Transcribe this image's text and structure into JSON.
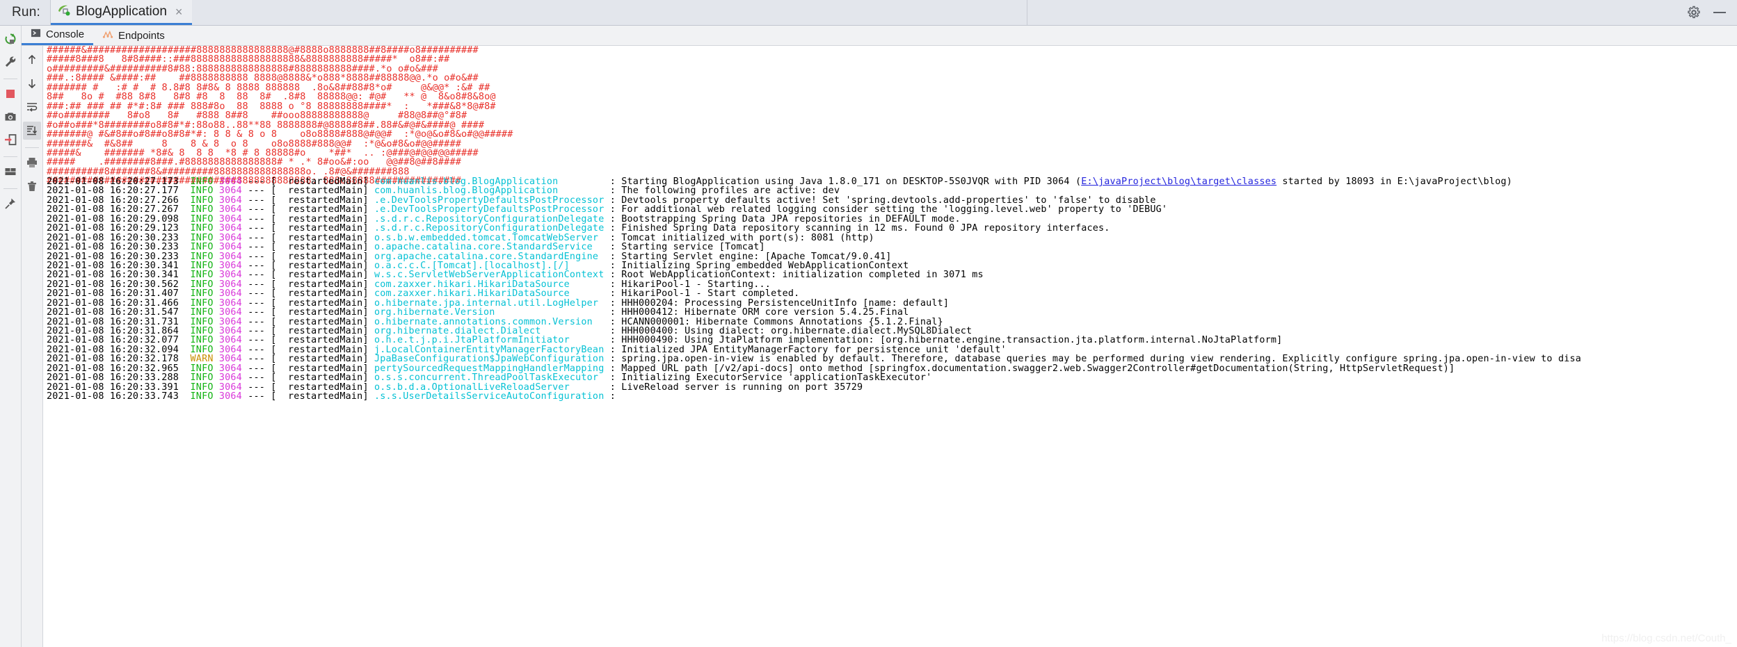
{
  "runbar": {
    "label": "Run:",
    "tab_title": "BlogApplication",
    "close_glyph": "×",
    "gear_name": "gear-icon",
    "minimize_name": "minimize-icon"
  },
  "left_toolbar": {
    "items": [
      {
        "name": "rerun-icon",
        "title": "Rerun"
      },
      {
        "name": "wrench-icon",
        "title": "Edit Configuration"
      },
      {
        "name": "stop-icon",
        "title": "Stop"
      },
      {
        "name": "camera-icon",
        "title": "Dump Threads"
      },
      {
        "name": "resume-icon",
        "title": "Resume Program"
      },
      {
        "name": "layout-icon",
        "title": "Layout"
      },
      {
        "name": "pin-icon",
        "title": "Pin Tab"
      }
    ]
  },
  "tabs": [
    {
      "label": "Console",
      "icon": "console-icon",
      "active": true
    },
    {
      "label": "Endpoints",
      "icon": "endpoints-icon",
      "active": false
    }
  ],
  "gutter_toolbar": {
    "items": [
      {
        "name": "arrow-up-icon",
        "title": "Up the Stack Trace"
      },
      {
        "name": "arrow-down-icon",
        "title": "Down the Stack Trace"
      },
      {
        "name": "soft-wrap-icon",
        "title": "Use Soft Wraps"
      },
      {
        "name": "scroll-to-end-icon",
        "title": "Scroll to the End",
        "selected": true
      },
      {
        "name": "print-icon",
        "title": "Print"
      },
      {
        "name": "trash-icon",
        "title": "Clear All"
      }
    ]
  },
  "banner": {
    "color": "#e8302a",
    "lines": [
      "######&###################8888888888888888@#8888o8888888##8####o8##########",
      "#####8###8   8#8####::###8888888888888888888&8888888888#####*  o8##:##",
      "o#########&##########8#88:8888888888888888#8888888888####.*o o#o&###",
      "###.:8#### &####:##    ##8888888888 8888@8888&*o888*8888##88888@@.*o o#o&##",
      "####### #   :# #  # 8.8#8 8#8& 8 8888 888888  .8o&8##88#8*o#     @&@@* :&# ##",
      "8##   8o #  #88 8#8   8#8 #8  8  88  8#  .8#8  88888@@: #@#   ** @  8&o8#8&8o@",
      "###:## ### ## #*#:8# ### 888#8o  88  8888 o °8 88888888####*  :   *###&8*8@#8#",
      "##o########   8#o8   8#   #888 8##8    ##ooo88888888888@     #88@8##@°#8#",
      "#o##o###*8########o8#8#*#:88o88..88**88 8888888#@8888#8##.88#&#@#&####@ ####",
      "#######@ #&#8##o#8##o8#8#*#: 8 8 & 8 o 8    o8o8888#888@#@@#  :*@o@&o#8&o#@@#####",
      "#######&  #&8##     8    8 & 8  o 8    o8o8888#888@@#  :*@&o#8&o#@@#####",
      "#####&    ####### *8#& 8  8 8  *8 # 8 88888#o    *##*  .. :@###@#@@#@@#####",
      "#####    .########8###.#8888888888888888# * .* 8#oo&#:oo   @@##8@##8####",
      "##########8#######8&#########8888888888888888o. .8#@&#######888",
      "#################################8888888888888: 888o88888###############"
    ]
  },
  "logs": [
    {
      "ts": "2021-01-08 16:20:27.173",
      "level": "INFO",
      "pid": "3064",
      "thread": "restartedMain",
      "cls": "com.huanlis.blog.BlogApplication",
      "msg": ": Starting BlogApplication using Java 1.8.0_171 on DESKTOP-5S0JVQR with PID 3064 (",
      "link": "E:\\javaProject\\blog\\target\\classes",
      "msg_after": " started by 18093 in E:\\javaProject\\blog)"
    },
    {
      "ts": "2021-01-08 16:20:27.177",
      "level": "INFO",
      "pid": "3064",
      "thread": "restartedMain",
      "cls": "com.huanlis.blog.BlogApplication",
      "msg": ": The following profiles are active: dev"
    },
    {
      "ts": "2021-01-08 16:20:27.266",
      "level": "INFO",
      "pid": "3064",
      "thread": "restartedMain",
      "cls": ".e.DevToolsPropertyDefaultsPostProcessor",
      "msg": ": Devtools property defaults active! Set 'spring.devtools.add-properties' to 'false' to disable"
    },
    {
      "ts": "2021-01-08 16:20:27.267",
      "level": "INFO",
      "pid": "3064",
      "thread": "restartedMain",
      "cls": ".e.DevToolsPropertyDefaultsPostProcessor",
      "msg": ": For additional web related logging consider setting the 'logging.level.web' property to 'DEBUG'"
    },
    {
      "ts": "2021-01-08 16:20:29.098",
      "level": "INFO",
      "pid": "3064",
      "thread": "restartedMain",
      "cls": ".s.d.r.c.RepositoryConfigurationDelegate",
      "msg": ": Bootstrapping Spring Data JPA repositories in DEFAULT mode."
    },
    {
      "ts": "2021-01-08 16:20:29.123",
      "level": "INFO",
      "pid": "3064",
      "thread": "restartedMain",
      "cls": ".s.d.r.c.RepositoryConfigurationDelegate",
      "msg": ": Finished Spring Data repository scanning in 12 ms. Found 0 JPA repository interfaces."
    },
    {
      "ts": "2021-01-08 16:20:30.233",
      "level": "INFO",
      "pid": "3064",
      "thread": "restartedMain",
      "cls": "o.s.b.w.embedded.tomcat.TomcatWebServer",
      "msg": ": Tomcat initialized with port(s): 8081 (http)"
    },
    {
      "ts": "2021-01-08 16:20:30.233",
      "level": "INFO",
      "pid": "3064",
      "thread": "restartedMain",
      "cls": "o.apache.catalina.core.StandardService",
      "msg": ": Starting service [Tomcat]"
    },
    {
      "ts": "2021-01-08 16:20:30.233",
      "level": "INFO",
      "pid": "3064",
      "thread": "restartedMain",
      "cls": "org.apache.catalina.core.StandardEngine",
      "msg": ": Starting Servlet engine: [Apache Tomcat/9.0.41]"
    },
    {
      "ts": "2021-01-08 16:20:30.341",
      "level": "INFO",
      "pid": "3064",
      "thread": "restartedMain",
      "cls": "o.a.c.c.C.[Tomcat].[localhost].[/]",
      "msg": ": Initializing Spring embedded WebApplicationContext"
    },
    {
      "ts": "2021-01-08 16:20:30.341",
      "level": "INFO",
      "pid": "3064",
      "thread": "restartedMain",
      "cls": "w.s.c.ServletWebServerApplicationContext",
      "msg": ": Root WebApplicationContext: initialization completed in 3071 ms"
    },
    {
      "ts": "2021-01-08 16:20:30.562",
      "level": "INFO",
      "pid": "3064",
      "thread": "restartedMain",
      "cls": "com.zaxxer.hikari.HikariDataSource",
      "msg": ": HikariPool-1 - Starting..."
    },
    {
      "ts": "2021-01-08 16:20:31.407",
      "level": "INFO",
      "pid": "3064",
      "thread": "restartedMain",
      "cls": "com.zaxxer.hikari.HikariDataSource",
      "msg": ": HikariPool-1 - Start completed."
    },
    {
      "ts": "2021-01-08 16:20:31.466",
      "level": "INFO",
      "pid": "3064",
      "thread": "restartedMain",
      "cls": "o.hibernate.jpa.internal.util.LogHelper",
      "msg": ": HHH000204: Processing PersistenceUnitInfo [name: default]"
    },
    {
      "ts": "2021-01-08 16:20:31.547",
      "level": "INFO",
      "pid": "3064",
      "thread": "restartedMain",
      "cls": "org.hibernate.Version",
      "msg": ": HHH000412: Hibernate ORM core version 5.4.25.Final"
    },
    {
      "ts": "2021-01-08 16:20:31.731",
      "level": "INFO",
      "pid": "3064",
      "thread": "restartedMain",
      "cls": "o.hibernate.annotations.common.Version",
      "msg": ": HCANN000001: Hibernate Commons Annotations {5.1.2.Final}"
    },
    {
      "ts": "2021-01-08 16:20:31.864",
      "level": "INFO",
      "pid": "3064",
      "thread": "restartedMain",
      "cls": "org.hibernate.dialect.Dialect",
      "msg": ": HHH000400: Using dialect: org.hibernate.dialect.MySQL8Dialect"
    },
    {
      "ts": "2021-01-08 16:20:32.077",
      "level": "INFO",
      "pid": "3064",
      "thread": "restartedMain",
      "cls": "o.h.e.t.j.p.i.JtaPlatformInitiator",
      "msg": ": HHH000490: Using JtaPlatform implementation: [org.hibernate.engine.transaction.jta.platform.internal.NoJtaPlatform]"
    },
    {
      "ts": "2021-01-08 16:20:32.094",
      "level": "INFO",
      "pid": "3064",
      "thread": "restartedMain",
      "cls": "j.LocalContainerEntityManagerFactoryBean",
      "msg": ": Initialized JPA EntityManagerFactory for persistence unit 'default'"
    },
    {
      "ts": "2021-01-08 16:20:32.178",
      "level": "WARN",
      "pid": "3064",
      "thread": "restartedMain",
      "cls": "JpaBaseConfiguration$JpaWebConfiguration",
      "msg": ": spring.jpa.open-in-view is enabled by default. Therefore, database queries may be performed during view rendering. Explicitly configure spring.jpa.open-in-view to disa"
    },
    {
      "ts": "2021-01-08 16:20:32.965",
      "level": "INFO",
      "pid": "3064",
      "thread": "restartedMain",
      "cls": "pertySourcedRequestMappingHandlerMapping",
      "msg": ": Mapped URL path [/v2/api-docs] onto method [springfox.documentation.swagger2.web.Swagger2Controller#getDocumentation(String, HttpServletRequest)]"
    },
    {
      "ts": "2021-01-08 16:20:33.288",
      "level": "INFO",
      "pid": "3064",
      "thread": "restartedMain",
      "cls": "o.s.s.concurrent.ThreadPoolTaskExecutor",
      "msg": ": Initializing ExecutorService 'applicationTaskExecutor'"
    },
    {
      "ts": "2021-01-08 16:20:33.391",
      "level": "INFO",
      "pid": "3064",
      "thread": "restartedMain",
      "cls": "o.s.b.d.a.OptionalLiveReloadServer",
      "msg": ": LiveReload server is running on port 35729"
    },
    {
      "ts": "2021-01-08 16:20:33.743",
      "level": "INFO",
      "pid": "3064",
      "thread": "restartedMain",
      "cls": ".s.s.UserDetailsServiceAutoConfiguration",
      "msg": ":"
    }
  ],
  "watermark": "https://blog.csdn.net/Couth_"
}
